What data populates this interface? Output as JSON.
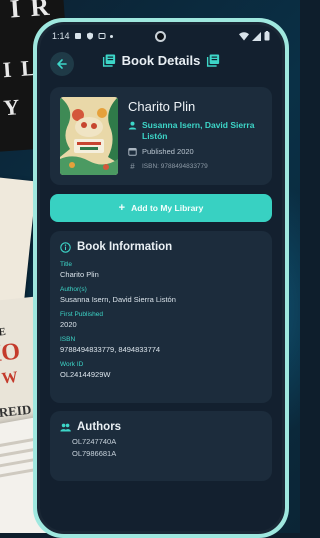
{
  "status_bar": {
    "time": "1:14"
  },
  "header": {
    "title": "Book Details"
  },
  "book": {
    "title": "Charito Plin",
    "authors": "Susanna Isern, David Sierra Listón",
    "published": "Published 2020",
    "isbn": "ISBN: 9788494833779"
  },
  "actions": {
    "add_label": "Add to My Library"
  },
  "book_information": {
    "title": "Book Information",
    "fields": [
      {
        "label": "Title",
        "value": "Charito Plin"
      },
      {
        "label": "Author(s)",
        "value": "Susanna Isern, David Sierra Listón"
      },
      {
        "label": "First Published",
        "value": "2020"
      },
      {
        "label": "ISBN",
        "value": "9788494833779, 8494833774"
      },
      {
        "label": "Work ID",
        "value": "OL24144929W"
      }
    ]
  },
  "authors_section": {
    "title": "Authors",
    "ids": [
      "OL7247740A",
      "OL7986681A"
    ]
  },
  "colors": {
    "accent": "#38d1c2",
    "card": "#1c2c3c",
    "background": "#13202f",
    "frame": "#9fe8df"
  }
}
